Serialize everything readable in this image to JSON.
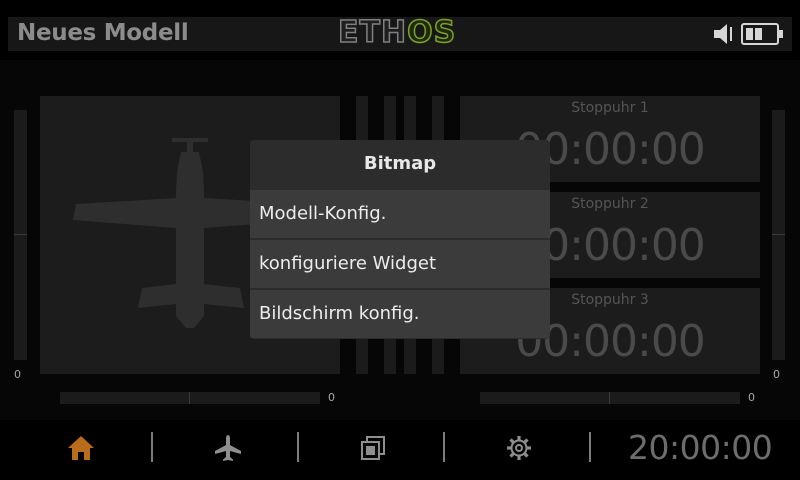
{
  "header": {
    "title": "Neues Modell",
    "logo_left": "ETH",
    "logo_right": "OS"
  },
  "status": {
    "volume_icon": "speaker-muted-icon",
    "battery_icon": "battery-icon"
  },
  "left_widget": {
    "icon": "airplane-silhouette",
    "rail_left_value": "0",
    "trim_value": "0"
  },
  "right_widget": {
    "rail_right_value": "0",
    "trim_value": "0"
  },
  "timers": [
    {
      "label": "Stoppuhr 1",
      "value": "00:00:00"
    },
    {
      "label": "Stoppuhr 2",
      "value": "00:00:00"
    },
    {
      "label": "Stoppuhr 3",
      "value": "00:00:00"
    }
  ],
  "popup": {
    "title": "Bitmap",
    "items": [
      "Modell-Konfig.",
      "konfiguriere Widget",
      "Bildschirm konfig."
    ]
  },
  "footer": {
    "tabs": [
      "home-icon",
      "airplane-icon",
      "screens-icon",
      "settings-gear-icon"
    ],
    "clock": "20:00:00",
    "active_color": "#b86d1a"
  }
}
